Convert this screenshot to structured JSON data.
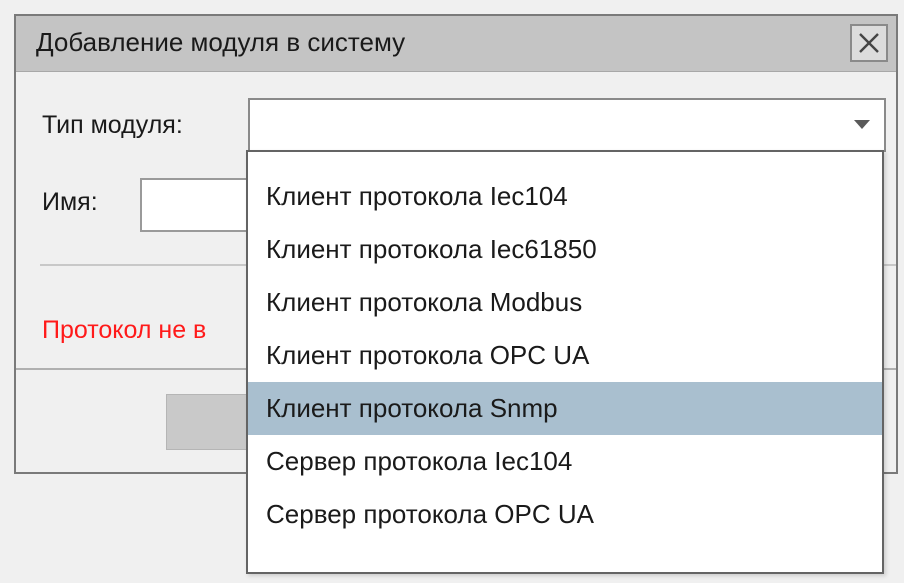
{
  "dialog": {
    "title": "Добавление модуля в систему",
    "close_icon": "close-icon"
  },
  "form": {
    "module_type_label": "Тип модуля:",
    "module_type_value": "",
    "name_label": "Имя:",
    "name_value": "",
    "error_text": "Протокол не в"
  },
  "dropdown": {
    "items": [
      {
        "label": "Клиент протокола Iec104",
        "selected": false
      },
      {
        "label": "Клиент протокола Iec61850",
        "selected": false
      },
      {
        "label": "Клиент протокола Modbus",
        "selected": false
      },
      {
        "label": "Клиент протокола OPC UA",
        "selected": false
      },
      {
        "label": "Клиент протокола Snmp",
        "selected": true
      },
      {
        "label": "Сервер протокола Iec104",
        "selected": false
      },
      {
        "label": "Сервер протокола OPC UA",
        "selected": false
      }
    ],
    "highlight_color": "#a9bfcf"
  },
  "colors": {
    "error": "#ff1a1a",
    "titlebar": "#c4c4c4"
  }
}
